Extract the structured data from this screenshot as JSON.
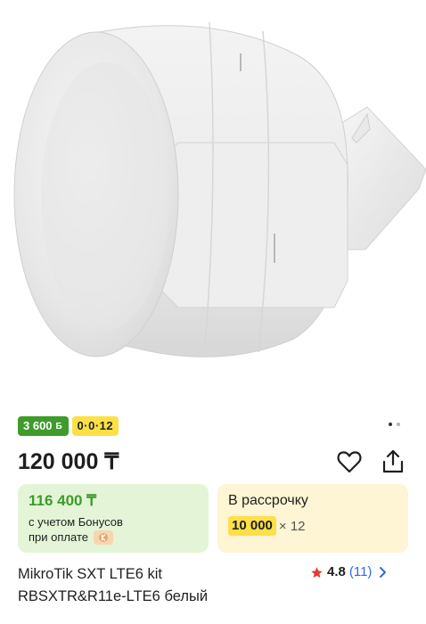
{
  "product": {
    "image_alt": "MikroTik SXT LTE6 kit",
    "title_line1": "MikroTik SXT LTE6 kit",
    "title_line2": "RBSXTR&R11e-LTE6 белый"
  },
  "badges": {
    "bonus_label": "3 600",
    "bonus_symbol": "Б",
    "installment_label": "0·0·12"
  },
  "gallery": {
    "total": 2,
    "active_index": 1
  },
  "price": {
    "value": "120 000 ₸"
  },
  "bonus_card": {
    "price": "116 400 ₸",
    "note_line1": "с учетом Бонусов",
    "note_line2": "при оплате"
  },
  "installment_card": {
    "title": "В рассрочку",
    "amount": "10 000",
    "months": "× 12"
  },
  "rating": {
    "value": "4.8",
    "count": "(11)"
  },
  "icons": {
    "favorite": "heart-icon",
    "share": "share-icon",
    "star": "star-icon",
    "chevron": "chevron-right-icon",
    "kaspi": "kaspi-logo-icon"
  },
  "colors": {
    "bonus_green": "#3e9b2c",
    "installment_yellow": "#fde047",
    "link_blue": "#2d6cdf",
    "star_red": "#e53935"
  }
}
